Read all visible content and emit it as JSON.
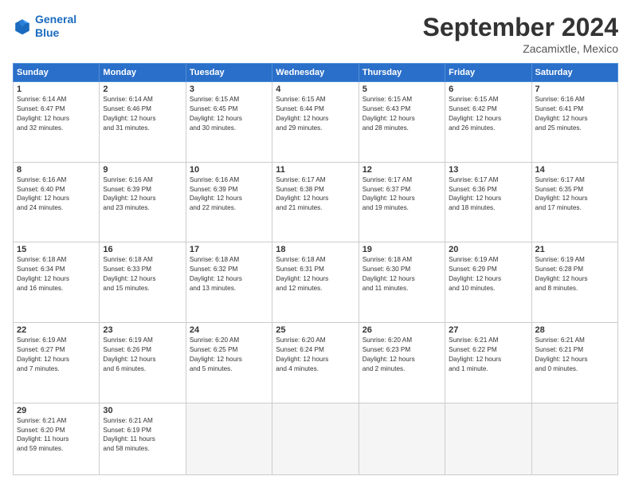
{
  "header": {
    "logo_line1": "General",
    "logo_line2": "Blue",
    "title": "September 2024",
    "location": "Zacamixtle, Mexico"
  },
  "days_of_week": [
    "Sunday",
    "Monday",
    "Tuesday",
    "Wednesday",
    "Thursday",
    "Friday",
    "Saturday"
  ],
  "weeks": [
    [
      {
        "day": "1",
        "info": "Sunrise: 6:14 AM\nSunset: 6:47 PM\nDaylight: 12 hours\nand 32 minutes."
      },
      {
        "day": "2",
        "info": "Sunrise: 6:14 AM\nSunset: 6:46 PM\nDaylight: 12 hours\nand 31 minutes."
      },
      {
        "day": "3",
        "info": "Sunrise: 6:15 AM\nSunset: 6:45 PM\nDaylight: 12 hours\nand 30 minutes."
      },
      {
        "day": "4",
        "info": "Sunrise: 6:15 AM\nSunset: 6:44 PM\nDaylight: 12 hours\nand 29 minutes."
      },
      {
        "day": "5",
        "info": "Sunrise: 6:15 AM\nSunset: 6:43 PM\nDaylight: 12 hours\nand 28 minutes."
      },
      {
        "day": "6",
        "info": "Sunrise: 6:15 AM\nSunset: 6:42 PM\nDaylight: 12 hours\nand 26 minutes."
      },
      {
        "day": "7",
        "info": "Sunrise: 6:16 AM\nSunset: 6:41 PM\nDaylight: 12 hours\nand 25 minutes."
      }
    ],
    [
      {
        "day": "8",
        "info": "Sunrise: 6:16 AM\nSunset: 6:40 PM\nDaylight: 12 hours\nand 24 minutes."
      },
      {
        "day": "9",
        "info": "Sunrise: 6:16 AM\nSunset: 6:39 PM\nDaylight: 12 hours\nand 23 minutes."
      },
      {
        "day": "10",
        "info": "Sunrise: 6:16 AM\nSunset: 6:39 PM\nDaylight: 12 hours\nand 22 minutes."
      },
      {
        "day": "11",
        "info": "Sunrise: 6:17 AM\nSunset: 6:38 PM\nDaylight: 12 hours\nand 21 minutes."
      },
      {
        "day": "12",
        "info": "Sunrise: 6:17 AM\nSunset: 6:37 PM\nDaylight: 12 hours\nand 19 minutes."
      },
      {
        "day": "13",
        "info": "Sunrise: 6:17 AM\nSunset: 6:36 PM\nDaylight: 12 hours\nand 18 minutes."
      },
      {
        "day": "14",
        "info": "Sunrise: 6:17 AM\nSunset: 6:35 PM\nDaylight: 12 hours\nand 17 minutes."
      }
    ],
    [
      {
        "day": "15",
        "info": "Sunrise: 6:18 AM\nSunset: 6:34 PM\nDaylight: 12 hours\nand 16 minutes."
      },
      {
        "day": "16",
        "info": "Sunrise: 6:18 AM\nSunset: 6:33 PM\nDaylight: 12 hours\nand 15 minutes."
      },
      {
        "day": "17",
        "info": "Sunrise: 6:18 AM\nSunset: 6:32 PM\nDaylight: 12 hours\nand 13 minutes."
      },
      {
        "day": "18",
        "info": "Sunrise: 6:18 AM\nSunset: 6:31 PM\nDaylight: 12 hours\nand 12 minutes."
      },
      {
        "day": "19",
        "info": "Sunrise: 6:18 AM\nSunset: 6:30 PM\nDaylight: 12 hours\nand 11 minutes."
      },
      {
        "day": "20",
        "info": "Sunrise: 6:19 AM\nSunset: 6:29 PM\nDaylight: 12 hours\nand 10 minutes."
      },
      {
        "day": "21",
        "info": "Sunrise: 6:19 AM\nSunset: 6:28 PM\nDaylight: 12 hours\nand 8 minutes."
      }
    ],
    [
      {
        "day": "22",
        "info": "Sunrise: 6:19 AM\nSunset: 6:27 PM\nDaylight: 12 hours\nand 7 minutes."
      },
      {
        "day": "23",
        "info": "Sunrise: 6:19 AM\nSunset: 6:26 PM\nDaylight: 12 hours\nand 6 minutes."
      },
      {
        "day": "24",
        "info": "Sunrise: 6:20 AM\nSunset: 6:25 PM\nDaylight: 12 hours\nand 5 minutes."
      },
      {
        "day": "25",
        "info": "Sunrise: 6:20 AM\nSunset: 6:24 PM\nDaylight: 12 hours\nand 4 minutes."
      },
      {
        "day": "26",
        "info": "Sunrise: 6:20 AM\nSunset: 6:23 PM\nDaylight: 12 hours\nand 2 minutes."
      },
      {
        "day": "27",
        "info": "Sunrise: 6:21 AM\nSunset: 6:22 PM\nDaylight: 12 hours\nand 1 minute."
      },
      {
        "day": "28",
        "info": "Sunrise: 6:21 AM\nSunset: 6:21 PM\nDaylight: 12 hours\nand 0 minutes."
      }
    ],
    [
      {
        "day": "29",
        "info": "Sunrise: 6:21 AM\nSunset: 6:20 PM\nDaylight: 11 hours\nand 59 minutes."
      },
      {
        "day": "30",
        "info": "Sunrise: 6:21 AM\nSunset: 6:19 PM\nDaylight: 11 hours\nand 58 minutes."
      },
      {
        "day": "",
        "info": ""
      },
      {
        "day": "",
        "info": ""
      },
      {
        "day": "",
        "info": ""
      },
      {
        "day": "",
        "info": ""
      },
      {
        "day": "",
        "info": ""
      }
    ]
  ]
}
